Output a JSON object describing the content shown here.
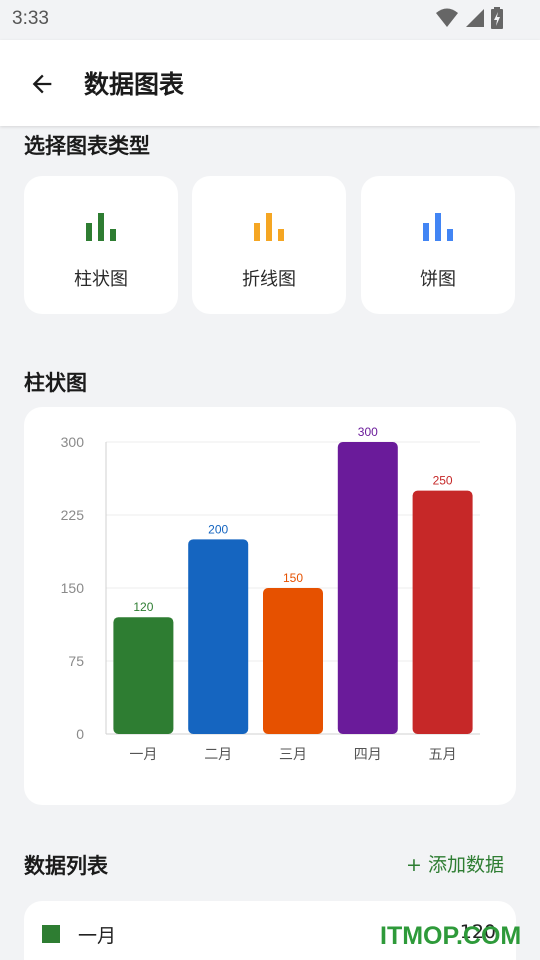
{
  "status_bar": {
    "time": "3:33"
  },
  "app_bar": {
    "title": "数据图表"
  },
  "type_section": {
    "title": "选择图表类型",
    "types": [
      {
        "label": "柱状图",
        "color": "#2e7d32",
        "icon": "bar-chart-icon"
      },
      {
        "label": "折线图",
        "color": "#f5a623",
        "icon": "bar-chart-icon"
      },
      {
        "label": "饼图",
        "color": "#4285f4",
        "icon": "bar-chart-icon"
      }
    ]
  },
  "chart_section": {
    "title": "柱状图"
  },
  "chart_data": {
    "type": "bar",
    "categories": [
      "一月",
      "二月",
      "三月",
      "四月",
      "五月"
    ],
    "values": [
      120,
      200,
      150,
      300,
      250
    ],
    "colors": [
      "#2e7d32",
      "#1565c0",
      "#e65100",
      "#6a1b9a",
      "#c62828"
    ],
    "ylim": [
      0,
      300
    ],
    "yticks": [
      0,
      75,
      150,
      225,
      300
    ],
    "grid": true,
    "title": "",
    "xlabel": "",
    "ylabel": ""
  },
  "list_section": {
    "title": "数据列表",
    "add_label": "+ 添加数据",
    "items": [
      {
        "label": "一月",
        "value": "120",
        "color": "#2e7d32"
      }
    ]
  },
  "watermark": "ITMOP.COM"
}
